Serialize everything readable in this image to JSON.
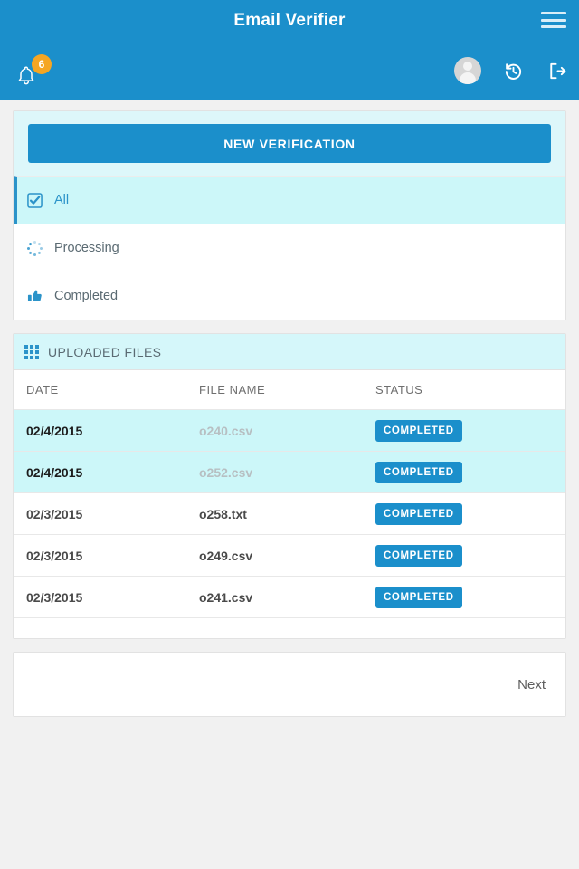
{
  "header": {
    "title": "Email Verifier",
    "menu_icon": "hamburger-menu-icon",
    "notifications": {
      "icon": "bell-icon",
      "count": "6"
    },
    "account_icon": "user-avatar-icon",
    "history_icon": "history-restore-icon",
    "logout_icon": "logout-icon",
    "bar_color": "#1b8fcb",
    "badge_color": "#f5a623"
  },
  "filters": {
    "new_verification_label": "NEW VERIFICATION",
    "items": [
      {
        "label": "All",
        "icon": "checkbox-checked-icon",
        "active": true
      },
      {
        "label": "Processing",
        "icon": "spinner-icon",
        "active": false
      },
      {
        "label": "Completed",
        "icon": "thumbs-up-icon",
        "active": false
      }
    ]
  },
  "uploaded_files": {
    "section_title": "UPLOADED FILES",
    "section_icon": "grid-icon",
    "columns": [
      "DATE",
      "FILE NAME",
      "STATUS"
    ],
    "rows": [
      {
        "date": "02/4/2015",
        "file": "o240.csv",
        "status": "COMPLETED",
        "highlight": true
      },
      {
        "date": "02/4/2015",
        "file": "o252.csv",
        "status": "COMPLETED",
        "highlight": true
      },
      {
        "date": "02/3/2015",
        "file": "o258.txt",
        "status": "COMPLETED",
        "highlight": false
      },
      {
        "date": "02/3/2015",
        "file": "o249.csv",
        "status": "COMPLETED",
        "highlight": false
      },
      {
        "date": "02/3/2015",
        "file": "o241.csv",
        "status": "COMPLETED",
        "highlight": false
      }
    ]
  },
  "pagination": {
    "next_label": "Next"
  },
  "theme": {
    "accent": "#1b8fcb",
    "highlight_row": "#ccf7f9",
    "section_header_bg": "#d5f7fa",
    "page_bg": "#f1f1f1"
  }
}
